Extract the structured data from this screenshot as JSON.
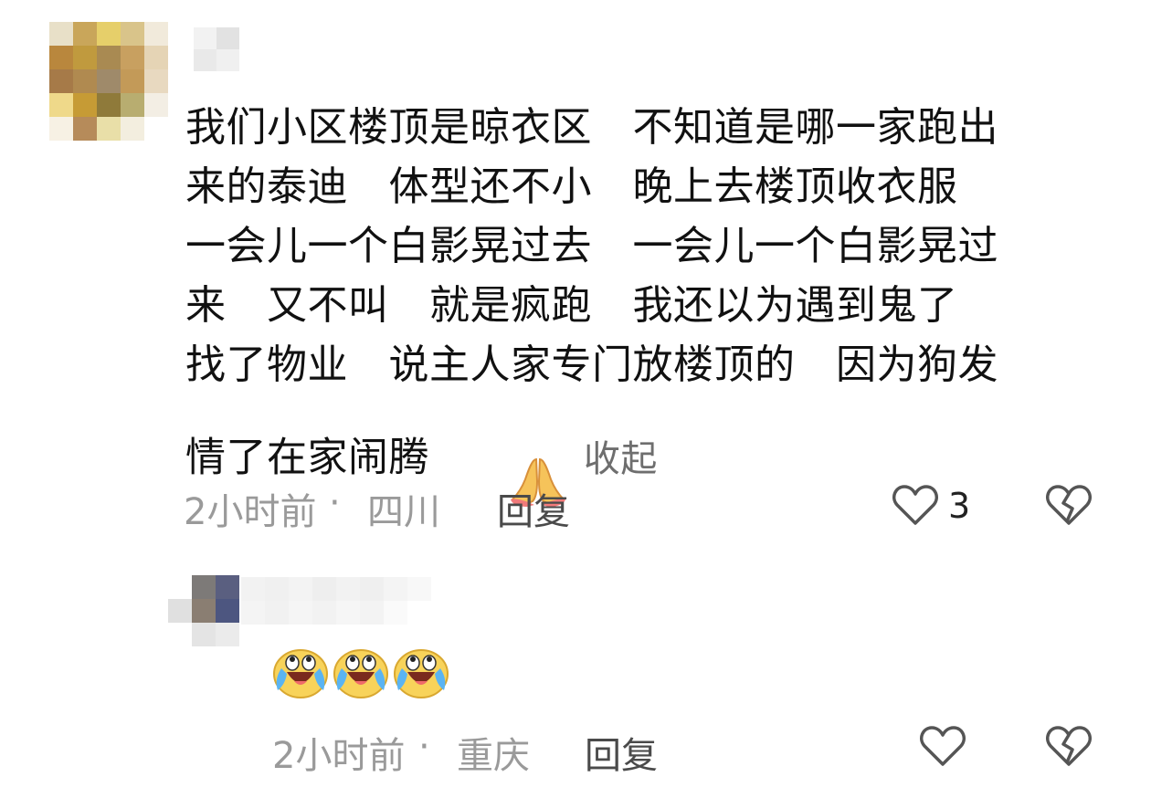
{
  "comment1": {
    "lines": [
      "我们小区楼顶是晾衣区　不知道是哪一家跑出",
      "来的泰迪　体型还不小　晚上去楼顶收衣服",
      "一会儿一个白影晃过去　一会儿一个白影晃过",
      "来　又不叫　就是疯跑　我还以为遇到鬼了",
      "找了物业　说主人家专门放楼顶的　因为狗发",
      "情了在家闹腾"
    ],
    "emoji": "pray-hands-icon",
    "collapse_label": "收起",
    "time": "2小时前",
    "location": "四川",
    "reply_label": "回复",
    "likes": "3"
  },
  "comment2": {
    "emoji_count": 3,
    "emoji": "crying-laugh-icon",
    "time": "2小时前",
    "location": "重庆",
    "reply_label": "回复"
  },
  "colors": {
    "text": "#111111",
    "meta": "#9a9a9a",
    "reply": "#4a4a4a",
    "icon_stroke": "#555555"
  }
}
